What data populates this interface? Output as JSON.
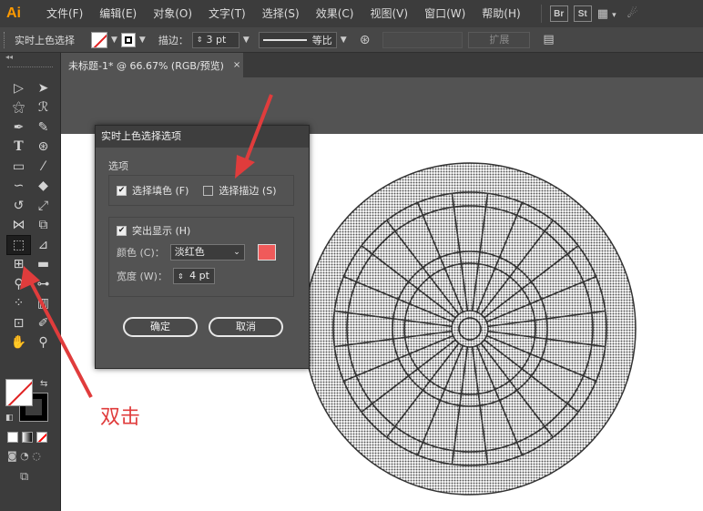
{
  "app": {
    "logo": "Ai",
    "menu": [
      "文件(F)",
      "编辑(E)",
      "对象(O)",
      "文字(T)",
      "选择(S)",
      "效果(C)",
      "视图(V)",
      "窗口(W)",
      "帮助(H)"
    ],
    "bridge_label": "Br",
    "stock_label": "St"
  },
  "control_bar": {
    "tool_name": "实时上色选择",
    "stroke_label": "描边：",
    "stroke_weight": "3 pt",
    "profile_label": "等比",
    "expand_label": "扩展"
  },
  "document_tab": {
    "title": "未标题-1* @ 66.67% (RGB/预览)",
    "close": "×"
  },
  "dialog": {
    "title": "实时上色选择选项",
    "options_label": "选项",
    "select_fill": "选择填色 (F)",
    "select_fill_checked": true,
    "select_stroke": "选择描边 (S)",
    "select_stroke_checked": false,
    "highlight_label": "突出显示 (H)",
    "highlight_checked": true,
    "color_label": "颜色 (C)：",
    "color_value": "淡红色",
    "highlight_color": "#f05a5a",
    "width_label": "宽度 (W)：",
    "width_value": "4 pt",
    "ok_label": "确定",
    "cancel_label": "取消"
  },
  "annotation": {
    "text": "双击",
    "color": "#e03c3c"
  },
  "icons": [
    "selection-icon",
    "direct-selection-icon",
    "magic-wand-icon",
    "lasso-icon",
    "pen-icon",
    "curvature-icon",
    "type-icon",
    "rotate-icon",
    "rectangle-icon",
    "brush-icon",
    "shaper-icon",
    "eraser-icon",
    "rotate-tool-icon",
    "scale-icon",
    "width-icon",
    "free-transform-icon",
    "live-paint-selection-icon",
    "perspective-icon",
    "mesh-icon",
    "gradient-icon",
    "eyedropper-icon",
    "blend-icon",
    "symbol-sprayer-icon",
    "graph-icon",
    "artboard-icon",
    "slice-icon",
    "hand-icon",
    "zoom-icon",
    "swap-icon",
    "default-colors-icon"
  ]
}
